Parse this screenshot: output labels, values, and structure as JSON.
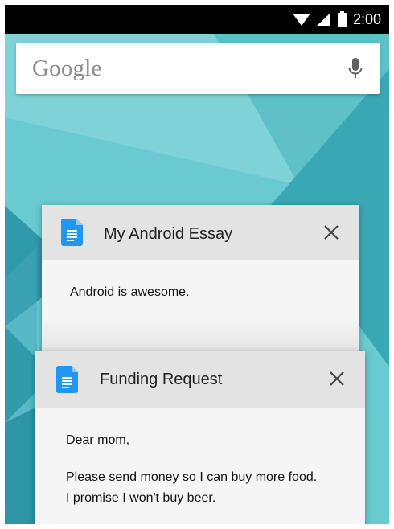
{
  "status": {
    "time": "2:00"
  },
  "search": {
    "logo": "Google"
  },
  "cards": [
    {
      "title": "My Android Essay",
      "body": "Android is awesome."
    },
    {
      "title": "Funding Request",
      "body_lines": [
        "Dear mom,",
        "",
        "Please send money so I can buy more food.",
        "I promise I won't buy beer."
      ]
    }
  ],
  "colors": {
    "wallpaper": "#66c9cf",
    "accent": "#2196f3",
    "statusbar": "#000000"
  },
  "icons": [
    "wifi-icon",
    "signal-icon",
    "battery-icon",
    "mic-icon",
    "docs-icon",
    "close-icon"
  ]
}
